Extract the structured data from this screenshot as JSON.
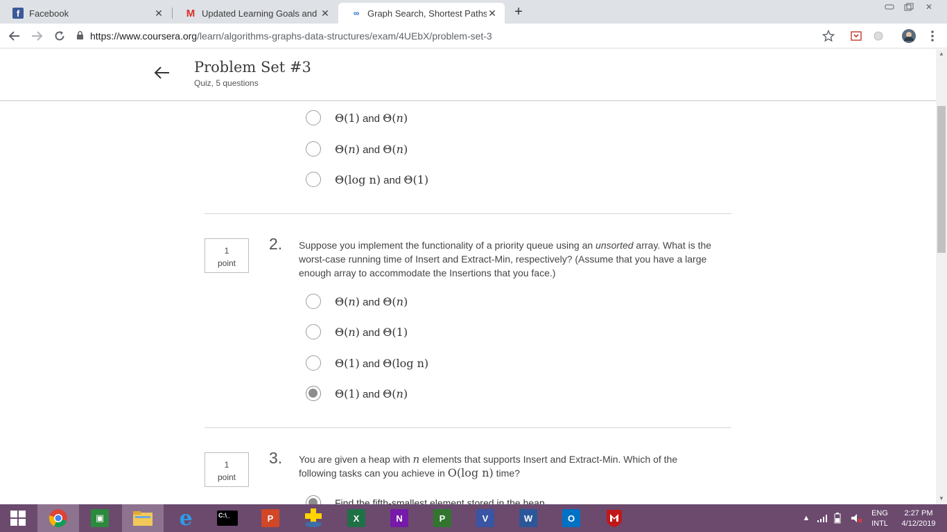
{
  "browser": {
    "tabs": [
      {
        "title": "Facebook",
        "icon": "facebook-icon",
        "active": false
      },
      {
        "title": "Updated Learning Goals and Tim",
        "icon": "gmail-icon",
        "active": false
      },
      {
        "title": "Graph Search, Shortest Paths, and",
        "icon": "coursera-icon",
        "active": true
      }
    ],
    "new_tab_label": "+",
    "url_host": "https://www.coursera.org",
    "url_path": "/learn/algorithms-graphs-data-structures/exam/4UEbX/problem-set-3"
  },
  "header": {
    "title": "Problem Set #3",
    "subtitle": "Quiz, 5 questions"
  },
  "q1_options": [
    {
      "a": "1",
      "b": "n",
      "checked": false
    },
    {
      "a": "n",
      "b": "n",
      "checked": false
    },
    {
      "a": "log n",
      "b": "1",
      "checked": false
    }
  ],
  "q2": {
    "number": "2.",
    "points": "1",
    "points_label": "point",
    "text_pre": "Suppose you implement the functionality of a priority queue using an ",
    "text_em": "unsorted",
    "text_post": " array. What is the worst-case running time of Insert and Extract-Min, respectively? (Assume that you have a large enough array to accommodate the Insertions that you face.)",
    "options": [
      {
        "a": "n",
        "b": "n",
        "checked": false
      },
      {
        "a": "n",
        "b": "1",
        "checked": false
      },
      {
        "a": "1",
        "b": "log n",
        "checked": false
      },
      {
        "a": "1",
        "b": "n",
        "checked": true
      }
    ]
  },
  "q3": {
    "number": "3.",
    "points": "1",
    "points_label": "point",
    "text_a": "You are given a heap with ",
    "text_var": "n",
    "text_b": " elements that supports Insert and Extract-Min. Which of the following tasks can you achieve in ",
    "text_bigo": "O(log n)",
    "text_c": " time?",
    "first_option": "Find the fifth-smallest element stored in the heap."
  },
  "and_word": "and",
  "taskbar": {
    "apps": [
      "start",
      "chrome",
      "store",
      "file-explorer",
      "internet-explorer",
      "cmd",
      "powerpoint",
      "game",
      "excel",
      "onenote",
      "project",
      "visio",
      "word",
      "outlook",
      "mcafee"
    ],
    "lang_top": "ENG",
    "lang_bottom": "INTL",
    "time": "2:27 PM",
    "date": "4/12/2019"
  },
  "colors": {
    "tabstrip": "#dee1e6",
    "taskbar": "#6b4a6e",
    "radio_checked": "#8d8d8d"
  }
}
